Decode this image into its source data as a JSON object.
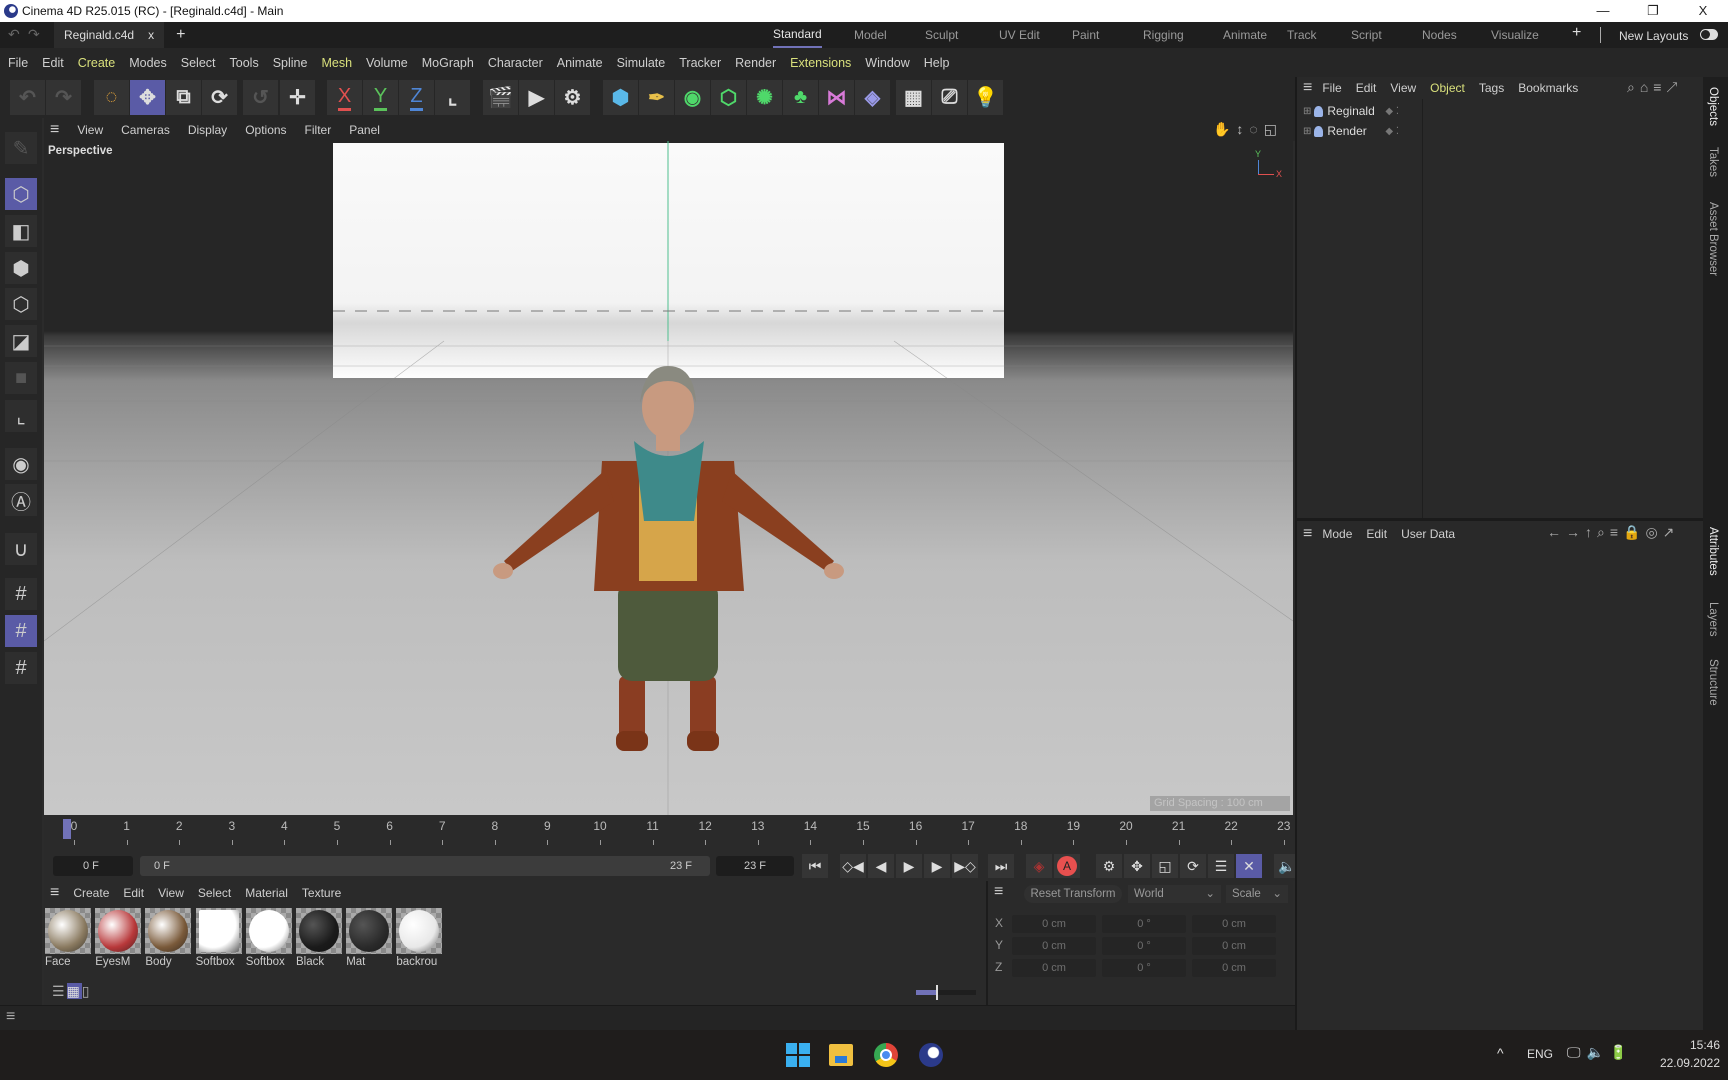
{
  "window": {
    "title": "Cinema 4D R25.015 (RC) - [Reginald.c4d] - Main",
    "minimize": "—",
    "maximize": "❐",
    "close": "X"
  },
  "doc_tab": {
    "name": "Reginald.c4d",
    "close": "x",
    "add": "+"
  },
  "layouts": [
    "Standard",
    "Model",
    "Sculpt",
    "UV Edit",
    "Paint",
    "Rigging",
    "Animate",
    "Track",
    "Script",
    "Nodes",
    "Visualize"
  ],
  "layouts_active": "Standard",
  "layouts_add": "+",
  "new_layouts": "New Layouts",
  "menu": [
    "File",
    "Edit",
    "Create",
    "Modes",
    "Select",
    "Tools",
    "Spline",
    "Mesh",
    "Volume",
    "MoGraph",
    "Character",
    "Animate",
    "Simulate",
    "Tracker",
    "Render",
    "Extensions",
    "Window",
    "Help"
  ],
  "toolbar": {
    "x_axis": "X",
    "y_axis": "Y",
    "z_axis": "Z"
  },
  "viewport": {
    "menu": [
      "View",
      "Cameras",
      "Display",
      "Options",
      "Filter",
      "Panel"
    ],
    "camera_label": "Perspective",
    "grid_spacing": "Grid Spacing : 100 cm",
    "axis_y": "Y",
    "axis_x": "X"
  },
  "timeline": {
    "ticks": [
      "0",
      "1",
      "2",
      "3",
      "4",
      "5",
      "6",
      "7",
      "8",
      "9",
      "10",
      "11",
      "12",
      "13",
      "14",
      "15",
      "16",
      "17",
      "18",
      "19",
      "20",
      "21",
      "22",
      "23"
    ],
    "current_frame": "0 F",
    "range_start": "0 F",
    "range_end": "23 F",
    "end_frame": "23 F",
    "autokey_label": "A"
  },
  "material_manager": {
    "menu": [
      "Create",
      "Edit",
      "View",
      "Select",
      "Material",
      "Texture"
    ],
    "materials": [
      {
        "name": "Face",
        "color": "#8a7a60"
      },
      {
        "name": "EyesM",
        "color": "#b8383a"
      },
      {
        "name": "Body",
        "color": "#7a5a3a"
      },
      {
        "name": "Softbox",
        "color": "#ffffff"
      },
      {
        "name": "Softbox",
        "color": "#ffffff"
      },
      {
        "name": "Black",
        "color": "#1a1a1a"
      },
      {
        "name": "Mat",
        "color": "#2a2a2a"
      },
      {
        "name": "backrou",
        "color": "#e8e8e8"
      }
    ]
  },
  "coordinates": {
    "reset": "Reset Transform",
    "space": "World",
    "mode": "Scale",
    "rows": [
      {
        "axis": "X",
        "pos": "0 cm",
        "rot": "0 °",
        "size": "0 cm"
      },
      {
        "axis": "Y",
        "pos": "0 cm",
        "rot": "0 °",
        "size": "0 cm"
      },
      {
        "axis": "Z",
        "pos": "0 cm",
        "rot": "0 °",
        "size": "0 cm"
      }
    ]
  },
  "object_manager": {
    "menu": [
      "File",
      "Edit",
      "View",
      "Object",
      "Tags",
      "Bookmarks"
    ],
    "objects": [
      "Reginald",
      "Render"
    ]
  },
  "attributes": {
    "menu": [
      "Mode",
      "Edit",
      "User Data"
    ]
  },
  "side_tabs": [
    "Objects",
    "Takes",
    "Asset Browser",
    "Attributes",
    "Layers",
    "Structure"
  ],
  "taskbar": {
    "lang": "ENG",
    "time": "15:46",
    "date": "22.09.2022",
    "chevron": "^"
  },
  "colors": {
    "accent": "#5a5ba6",
    "highlight_menu": "#d9e07c",
    "x_axis": "#e0504f",
    "y_axis": "#5bc25b",
    "z_axis": "#4f86d6"
  }
}
